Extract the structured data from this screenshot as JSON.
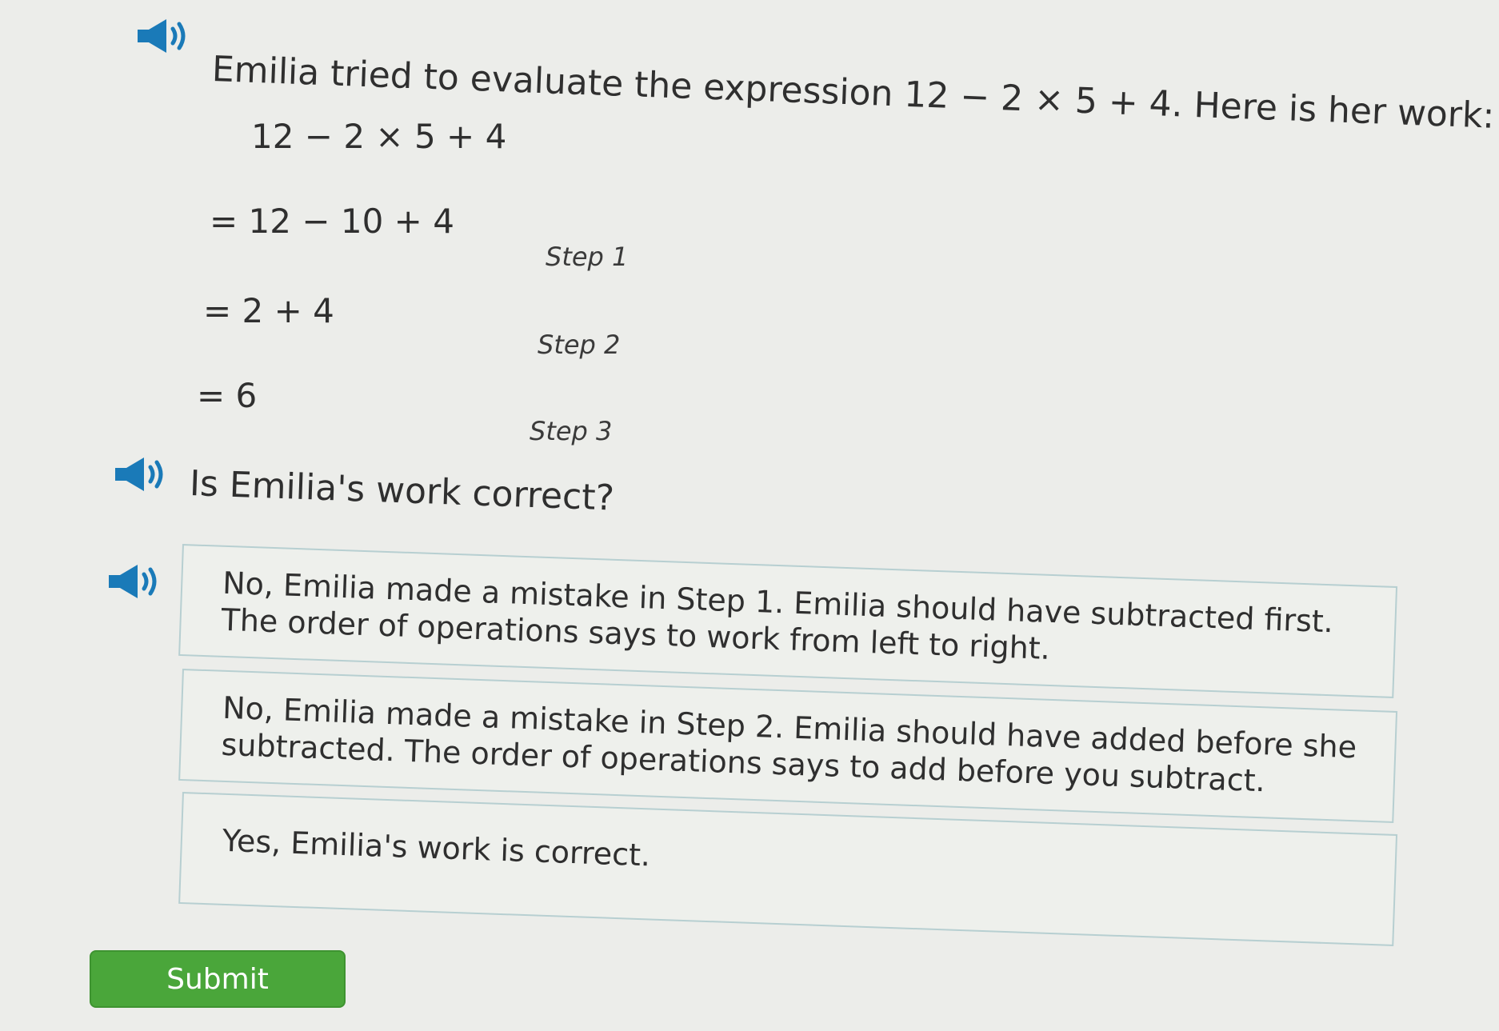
{
  "question": {
    "prompt": "Emilia tried to evaluate the expression 12 − 2 × 5 + 4. Here is her work:",
    "work": [
      {
        "expression": "12 − 2 × 5 + 4",
        "step": ""
      },
      {
        "expression": "= 12 − 10 + 4",
        "step": "Step 1"
      },
      {
        "expression": "= 2 + 4",
        "step": "Step 2"
      },
      {
        "expression": "= 6",
        "step": "Step 3"
      }
    ],
    "ask": "Is Emilia's work correct?"
  },
  "choices": [
    {
      "text": "No, Emilia made a mistake in Step 1. Emilia should have subtracted first. The order of operations says to work from left to right."
    },
    {
      "text": "No, Emilia made a mistake in Step 2. Emilia should have added before she subtracted. The order of operations says to add before you subtract."
    },
    {
      "text": "Yes, Emilia's work is correct."
    }
  ],
  "submit": {
    "label": "Submit"
  },
  "icons": {
    "speaker": "speaker-icon",
    "speaker_color": "#1a7ab8"
  },
  "colors": {
    "submit_green": "#4aa63a",
    "choice_border": "#b7cfd1"
  }
}
